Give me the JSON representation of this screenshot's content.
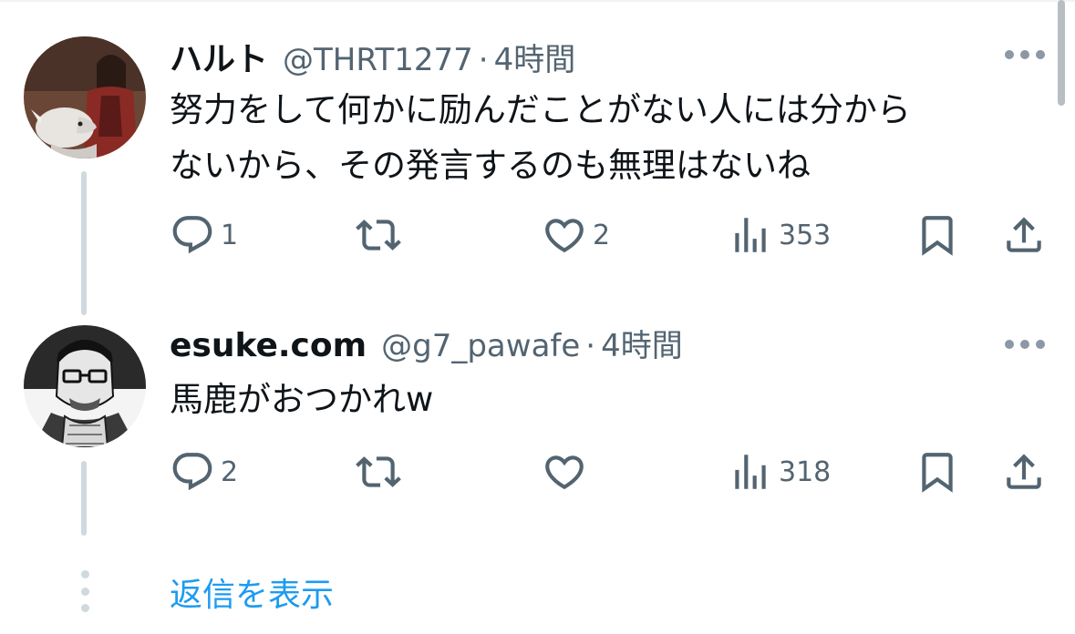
{
  "tweets": [
    {
      "name": "ハルト",
      "handle": "@THRT1277",
      "separator": "·",
      "time": "4時間",
      "text": "努力をして何かに励んだことがない人には分から\nないから、その発言するのも無理はないね",
      "replies": "1",
      "retweets": "",
      "likes": "2",
      "views": "353",
      "avatar_icon": "user-avatar-woman-with-wolf"
    },
    {
      "name": "esuke.com",
      "handle": "@g7_pawafe",
      "separator": "·",
      "time": "4時間",
      "text": "馬鹿がおつかれw",
      "replies": "2",
      "retweets": "",
      "likes": "",
      "views": "318",
      "avatar_icon": "user-avatar-manga-man-with-glasses"
    }
  ],
  "show_replies_label": "返信を表示",
  "colors": {
    "accent": "#1d9bf0",
    "secondary_text": "#536471",
    "primary_text": "#0f1419",
    "thread_line": "#cfd9de"
  },
  "icons": [
    "reply-icon",
    "retweet-icon",
    "like-icon",
    "views-icon",
    "bookmark-icon",
    "share-icon",
    "more-icon"
  ]
}
